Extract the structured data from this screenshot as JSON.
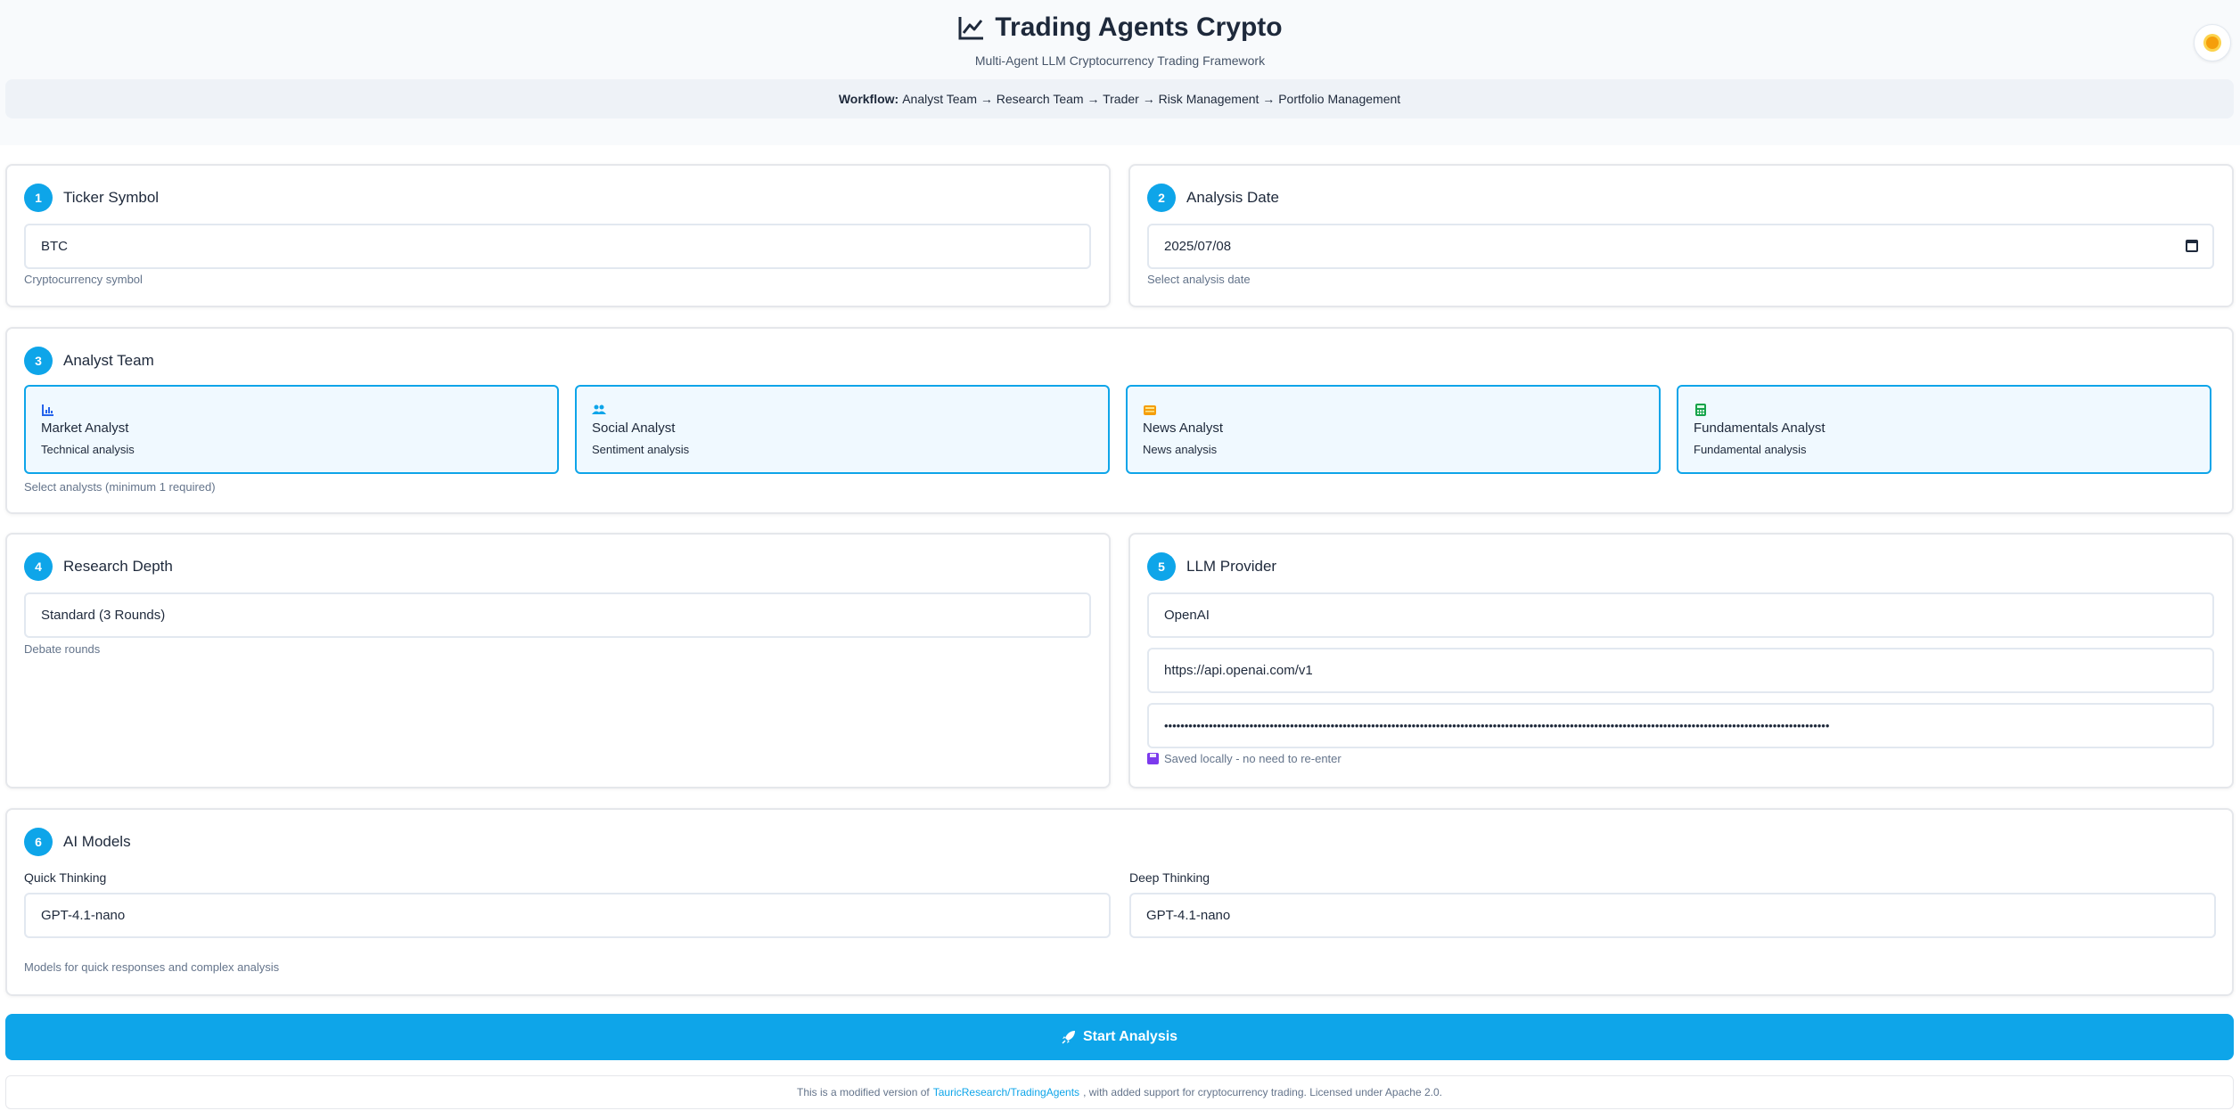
{
  "header": {
    "title": "Trading Agents Crypto",
    "subtitle": "Multi-Agent LLM Cryptocurrency Trading Framework",
    "title_icon": "chart-line-icon",
    "theme_icon": "sun-icon"
  },
  "workflow": {
    "label": "Workflow:",
    "steps": "Analyst Team → Research Team → Trader → Risk Management → Portfolio Management"
  },
  "ticker": {
    "number": "1",
    "title": "Ticker Symbol",
    "value": "BTC",
    "hint": "Cryptocurrency symbol"
  },
  "date": {
    "number": "2",
    "title": "Analysis Date",
    "value": "2025/07/08",
    "hint": "Select analysis date"
  },
  "analysts": {
    "number": "3",
    "title": "Analyst Team",
    "hint": "Select analysts (minimum 1 required)",
    "items": [
      {
        "name": "Market Analyst",
        "desc": "Technical analysis",
        "icon": "bar-chart-icon",
        "selected": true
      },
      {
        "name": "Social Analyst",
        "desc": "Sentiment analysis",
        "icon": "users-icon",
        "selected": true
      },
      {
        "name": "News Analyst",
        "desc": "News analysis",
        "icon": "newspaper-icon",
        "selected": true
      },
      {
        "name": "Fundamentals Analyst",
        "desc": "Fundamental analysis",
        "icon": "calculator-icon",
        "selected": true
      }
    ]
  },
  "depth": {
    "number": "4",
    "title": "Research Depth",
    "value": "Standard (3 Rounds)",
    "hint": "Debate rounds"
  },
  "llm": {
    "number": "5",
    "title": "LLM Provider",
    "provider": "OpenAI",
    "url": "https://api.openai.com/v1",
    "api_key": "••••••••••••••••••••••••••••••••••••••••••••••••••••••••••••••••••••••••••••••••••••••••••••••••••••••••••••••••••••••••••••••••••••••••••••••••••••••••••••••••••••",
    "saved_note": "Saved locally - no need to re-enter"
  },
  "models": {
    "number": "6",
    "title": "AI Models",
    "quick_label": "Quick Thinking",
    "quick_value": "GPT-4.1-nano",
    "deep_label": "Deep Thinking",
    "deep_value": "GPT-4.1-nano",
    "hint": "Models for quick responses and complex analysis"
  },
  "start_button": "Start Analysis",
  "footer": {
    "prefix": "This is a modified version of",
    "link": "TauricResearch/TradingAgents",
    "suffix": ", with added support for cryptocurrency trading. Licensed under Apache 2.0."
  },
  "colors": {
    "accent": "#0ea5e9",
    "selected_bg": "#f0f9ff",
    "text": "#1e293b"
  }
}
